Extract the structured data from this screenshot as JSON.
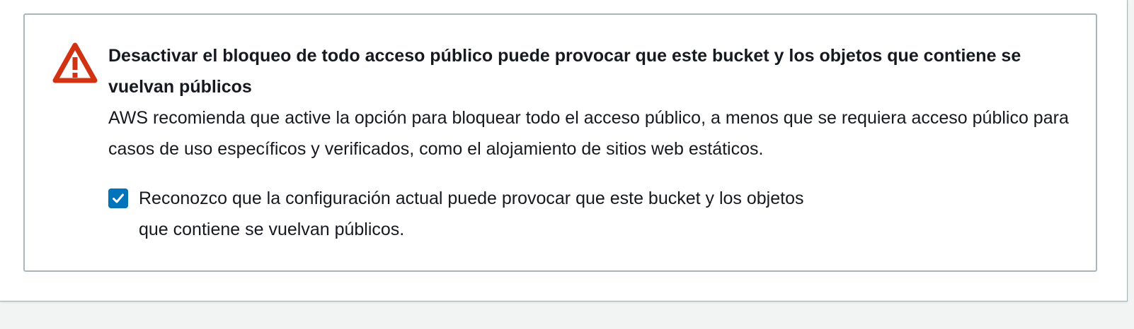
{
  "colors": {
    "warning_red": "#d13212",
    "checkbox_blue": "#0073bb",
    "border_gray": "#aab7b8",
    "text": "#16191f"
  },
  "alert": {
    "icon": "warning-icon",
    "title": "Desactivar el bloqueo de todo acceso público puede provocar que este bucket y los objetos que contiene se vuelvan públicos",
    "message": "AWS recomienda que active la opción para bloquear todo el acceso público, a menos que se requiera acceso público para casos de uso específicos y verificados, como el alojamiento de sitios web estáticos.",
    "acknowledgement": {
      "checked": true,
      "label": "Reconozco que la configuración actual puede provocar que este bucket y los objetos que contiene se vuelvan públicos."
    }
  }
}
